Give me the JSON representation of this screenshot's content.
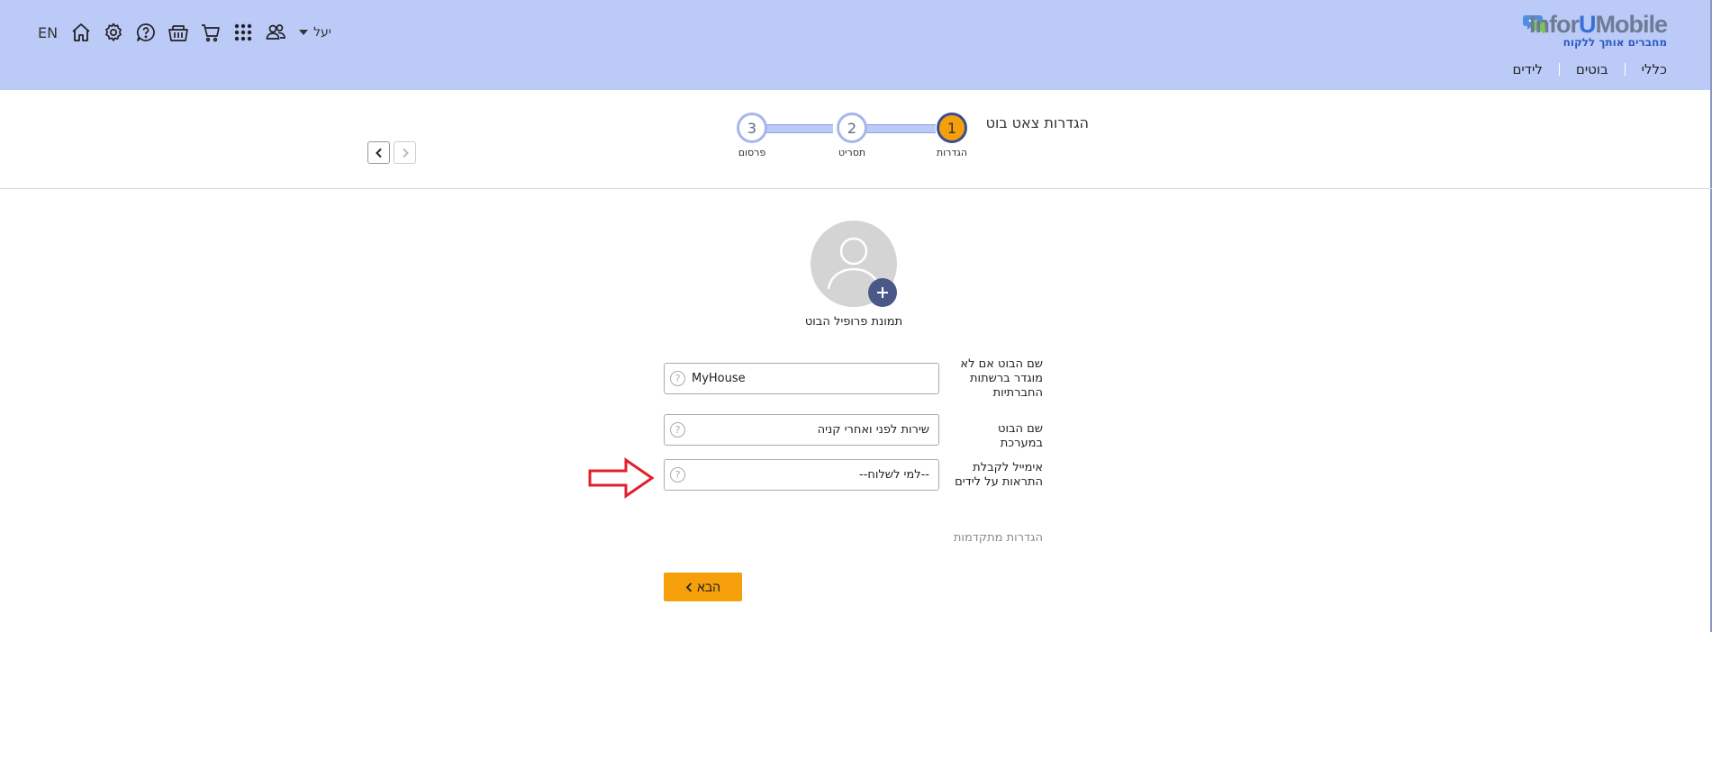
{
  "header": {
    "logo": {
      "name_part1": "Infor",
      "name_part2": "U",
      "name_part3": "Mobile",
      "tagline": "מחברים אותך ללקוח"
    },
    "nav": [
      {
        "label": "כללי"
      },
      {
        "label": "בוטים"
      },
      {
        "label": "לידים"
      }
    ],
    "toolbar": {
      "language": "EN",
      "user_name": "יעל",
      "icons": [
        "home-icon",
        "gear-icon",
        "help-chat-icon",
        "basket-icon",
        "cart-icon",
        "apps-grid-icon",
        "users-icon",
        "user-dropdown-caret-icon"
      ]
    }
  },
  "wizard": {
    "title": "הגדרות צאט בוט",
    "steps": [
      {
        "number": "1",
        "label": "הגדרות",
        "active": true
      },
      {
        "number": "2",
        "label": "תסריט",
        "active": false
      },
      {
        "number": "3",
        "label": "פרסום",
        "active": false
      }
    ],
    "arrows": [
      "chevron-left-icon",
      "chevron-right-icon"
    ]
  },
  "profile": {
    "caption": "תמונת פרופיל הבוט",
    "add_icon": "plus-icon",
    "avatar_icon": "person-icon"
  },
  "form": {
    "bot_name_label": "שם הבוט אם לא מוגדר ברשתות החברתיות",
    "bot_name_value": "MyHouse",
    "system_name_label": "שם הבוט במערכת",
    "system_name_value": "שירות לפני ואחרי קניה",
    "email_label": "אימייל לקבלת התראות על לידים",
    "email_value": "--למי לשלוח--",
    "help_glyph": "?",
    "advanced_link": "הגדרות מתקדמות",
    "next_button": "הבא"
  },
  "colors": {
    "header_bg": "#bccaf8",
    "accent_orange": "#f5a00a",
    "step_navy": "#3a4d8f",
    "annotation_red": "#e0202a"
  }
}
